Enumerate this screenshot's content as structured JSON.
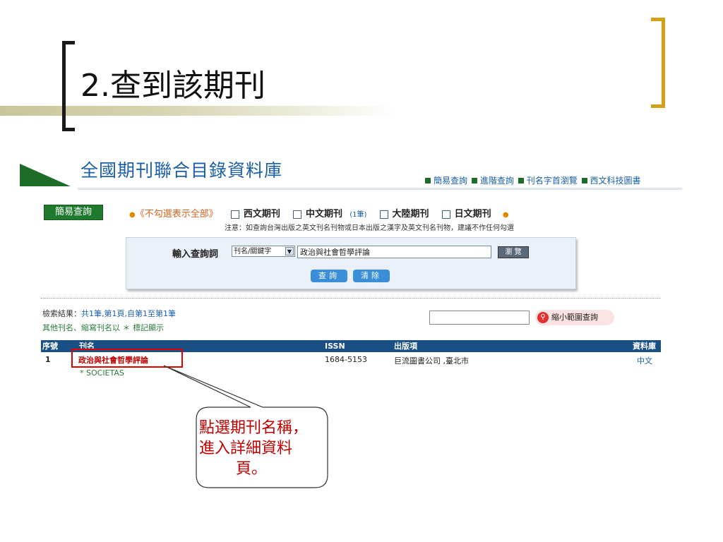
{
  "slide": {
    "title": "2.查到該期刊"
  },
  "site": {
    "title": "全國期刊聯合目錄資料庫",
    "nav": [
      "簡易查詢",
      "進階查詢",
      "刊名字首瀏覽",
      "西文科技圖書"
    ]
  },
  "search": {
    "tab_label": "簡易查詢",
    "unchecked_all": "《不勾選表示全部》",
    "categories": [
      {
        "label": "西文期刊",
        "count": ""
      },
      {
        "label": "中文期刊",
        "count": "(1筆)"
      },
      {
        "label": "大陸期刊",
        "count": ""
      },
      {
        "label": "日文期刊",
        "count": ""
      }
    ],
    "notice": "注意：如查詢台灣出版之英文刊名刊物或日本出版之漢字及英文刊名刊物，建議不作任何勾選",
    "input_label": "輸入查詢詞",
    "field_select": "刊名/關鍵字",
    "query_value": "政治與社會哲學評論",
    "browse_label": "瀏 覽",
    "search_label": "查詢",
    "clear_label": "清除"
  },
  "results": {
    "summary_label": "檢索結果：",
    "summary_value": "共1筆,第1頁,自第1至第1筆",
    "note": "其他刊名、縮寫刊名以 ＊ 標記顯示",
    "narrow_label": "縮小範圍查詢",
    "columns": [
      "序號",
      "刊名",
      "ISSN",
      "出版項",
      "資料庫"
    ],
    "rows": [
      {
        "no": "1",
        "title": "政治與社會哲學評論",
        "alt_title": "* SOCIETAS",
        "issn": "1684-5153",
        "publisher": "巨流圖書公司 ,臺北市",
        "database": "中文"
      }
    ]
  },
  "callout": {
    "line1": "點選期刊名稱，",
    "line2": "進入詳細資料",
    "line3": "頁。"
  }
}
